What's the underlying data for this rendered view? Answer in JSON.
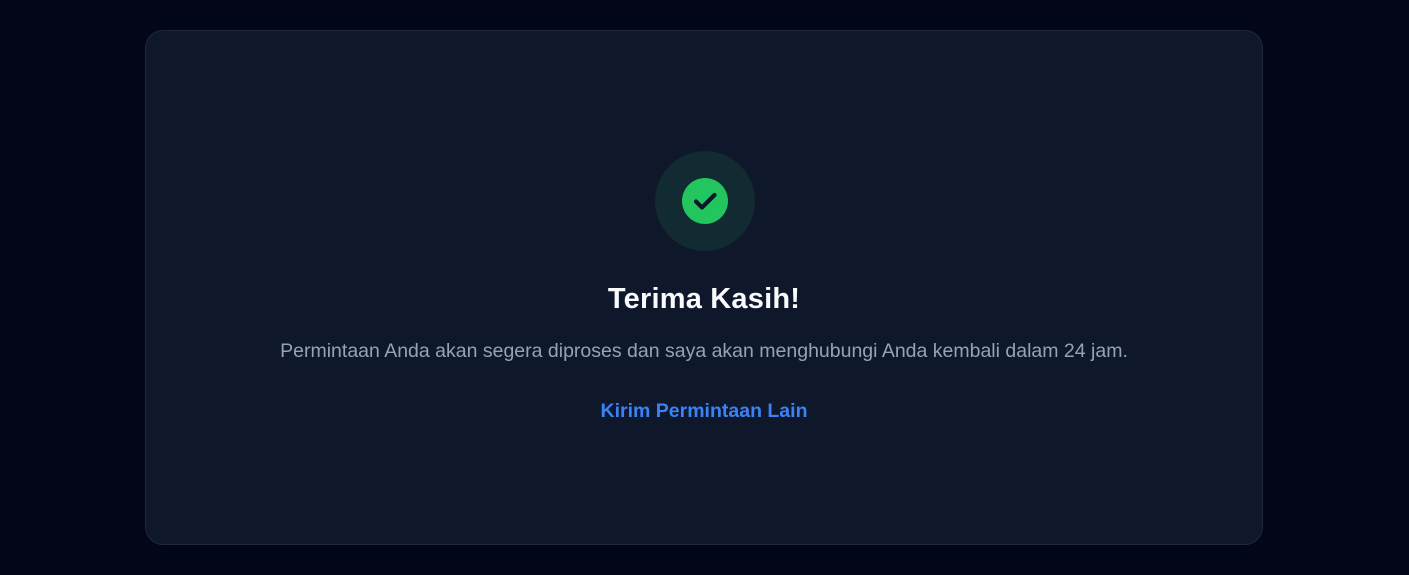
{
  "success": {
    "icon": "check-circle-icon",
    "title": "Terima Kasih!",
    "message": "Permintaan Anda akan segera diproses dan saya akan menghubungi Anda kembali dalam 24 jam.",
    "action_label": "Kirim Permintaan Lain"
  },
  "colors": {
    "page_background": "#020617",
    "card_background": "#0f172a",
    "success_green": "#22c55e",
    "link_blue": "#3b82f6",
    "muted_text": "#94a3b8"
  }
}
